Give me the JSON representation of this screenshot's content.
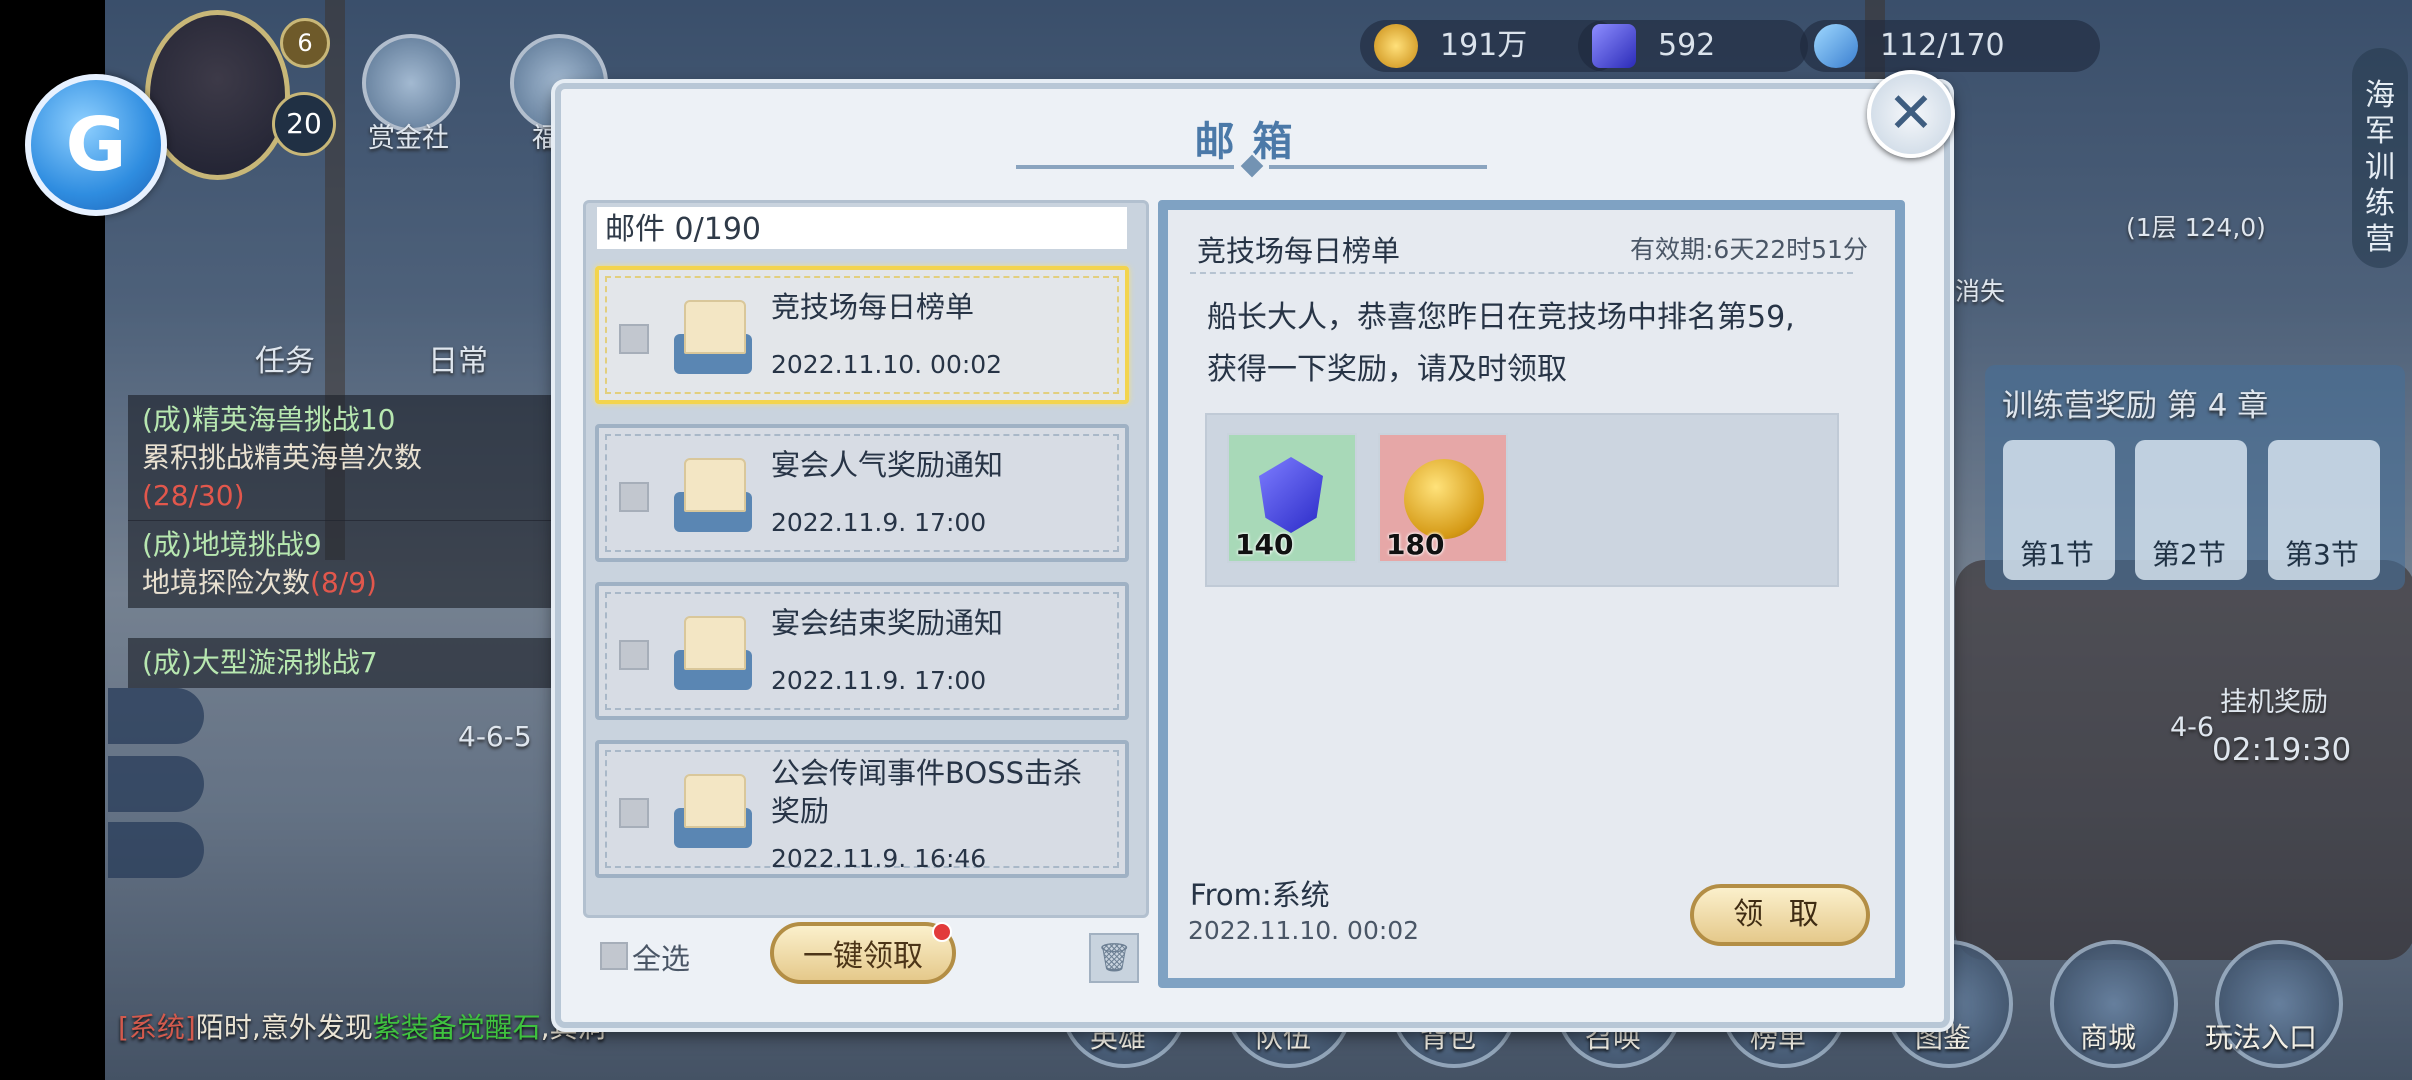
{
  "header": {
    "player_level_badge": "6",
    "player_rank": "20",
    "top_menu": {
      "bounty_society": "赏金社",
      "partial_label": "福"
    },
    "resources": [
      {
        "icon": "gold-coin-icon",
        "value": "191万"
      },
      {
        "icon": "gem-icon",
        "value": "592"
      },
      {
        "icon": "stamina-icon",
        "value": "112/170"
      }
    ],
    "side_vertical_label": "海军训练营",
    "floor_info": "(1层 124,0)",
    "disappear_text": "消失"
  },
  "tasks": {
    "tab_task": "任务",
    "tab_daily": "日常",
    "items": [
      {
        "title": "(成)精英海兽挑战10",
        "desc": "累积挑战精英海兽次数",
        "progress": "(28/30)"
      },
      {
        "title": "(成)地境挑战9",
        "desc": "地境探险次数",
        "progress": "(8/9)"
      },
      {
        "title": "(成)大型漩涡挑战7",
        "desc": "",
        "progress": ""
      }
    ],
    "stage_label": "4-6-5"
  },
  "training": {
    "title": "训练营奖励 第 4 章",
    "sections": [
      "第1节",
      "第2节",
      "第3节"
    ],
    "idle_reward": "挂机奖励",
    "idle_stage": "4-6",
    "idle_timer": "02:19:30"
  },
  "bottom_nav": [
    "英雄",
    "队伍",
    "背包",
    "召唤",
    "榜单",
    "图鉴",
    "商城",
    "玩法入口"
  ],
  "chat": {
    "channel": "[系统]",
    "message": "陌时,意外发现",
    "highlight": "紫装备觉醒石",
    "suffix": ",其洞"
  },
  "mailbox": {
    "title": "邮箱",
    "count_label": "邮件 0/190",
    "mails": [
      {
        "title": "竞技场每日榜单",
        "date": "2022.11.10. 00:02",
        "selected": true
      },
      {
        "title": "宴会人气奖励通知",
        "date": "2022.11.9. 17:00",
        "selected": false
      },
      {
        "title": "宴会结束奖励通知",
        "date": "2022.11.9. 17:00",
        "selected": false
      },
      {
        "title": "公会传闻事件BOSS击杀奖励",
        "date": "2022.11.9. 16:46",
        "selected": false
      }
    ],
    "select_all": "全选",
    "claim_all": "一键领取",
    "detail": {
      "title": "竞技场每日榜单",
      "validity": "有效期:6天22时51分",
      "body_line1": "船长大人，恭喜您昨日在竞技场中排名第59,",
      "body_line2": "获得一下奖励，请及时领取",
      "rewards": [
        {
          "icon": "gem-icon",
          "amount": "140",
          "bg": "#a8d9b8"
        },
        {
          "icon": "gold-coin-icon",
          "amount": "180",
          "bg": "#e6a7a7"
        }
      ],
      "from": "From:系统",
      "date": "2022.11.10. 00:02",
      "claim": "领 取"
    }
  }
}
